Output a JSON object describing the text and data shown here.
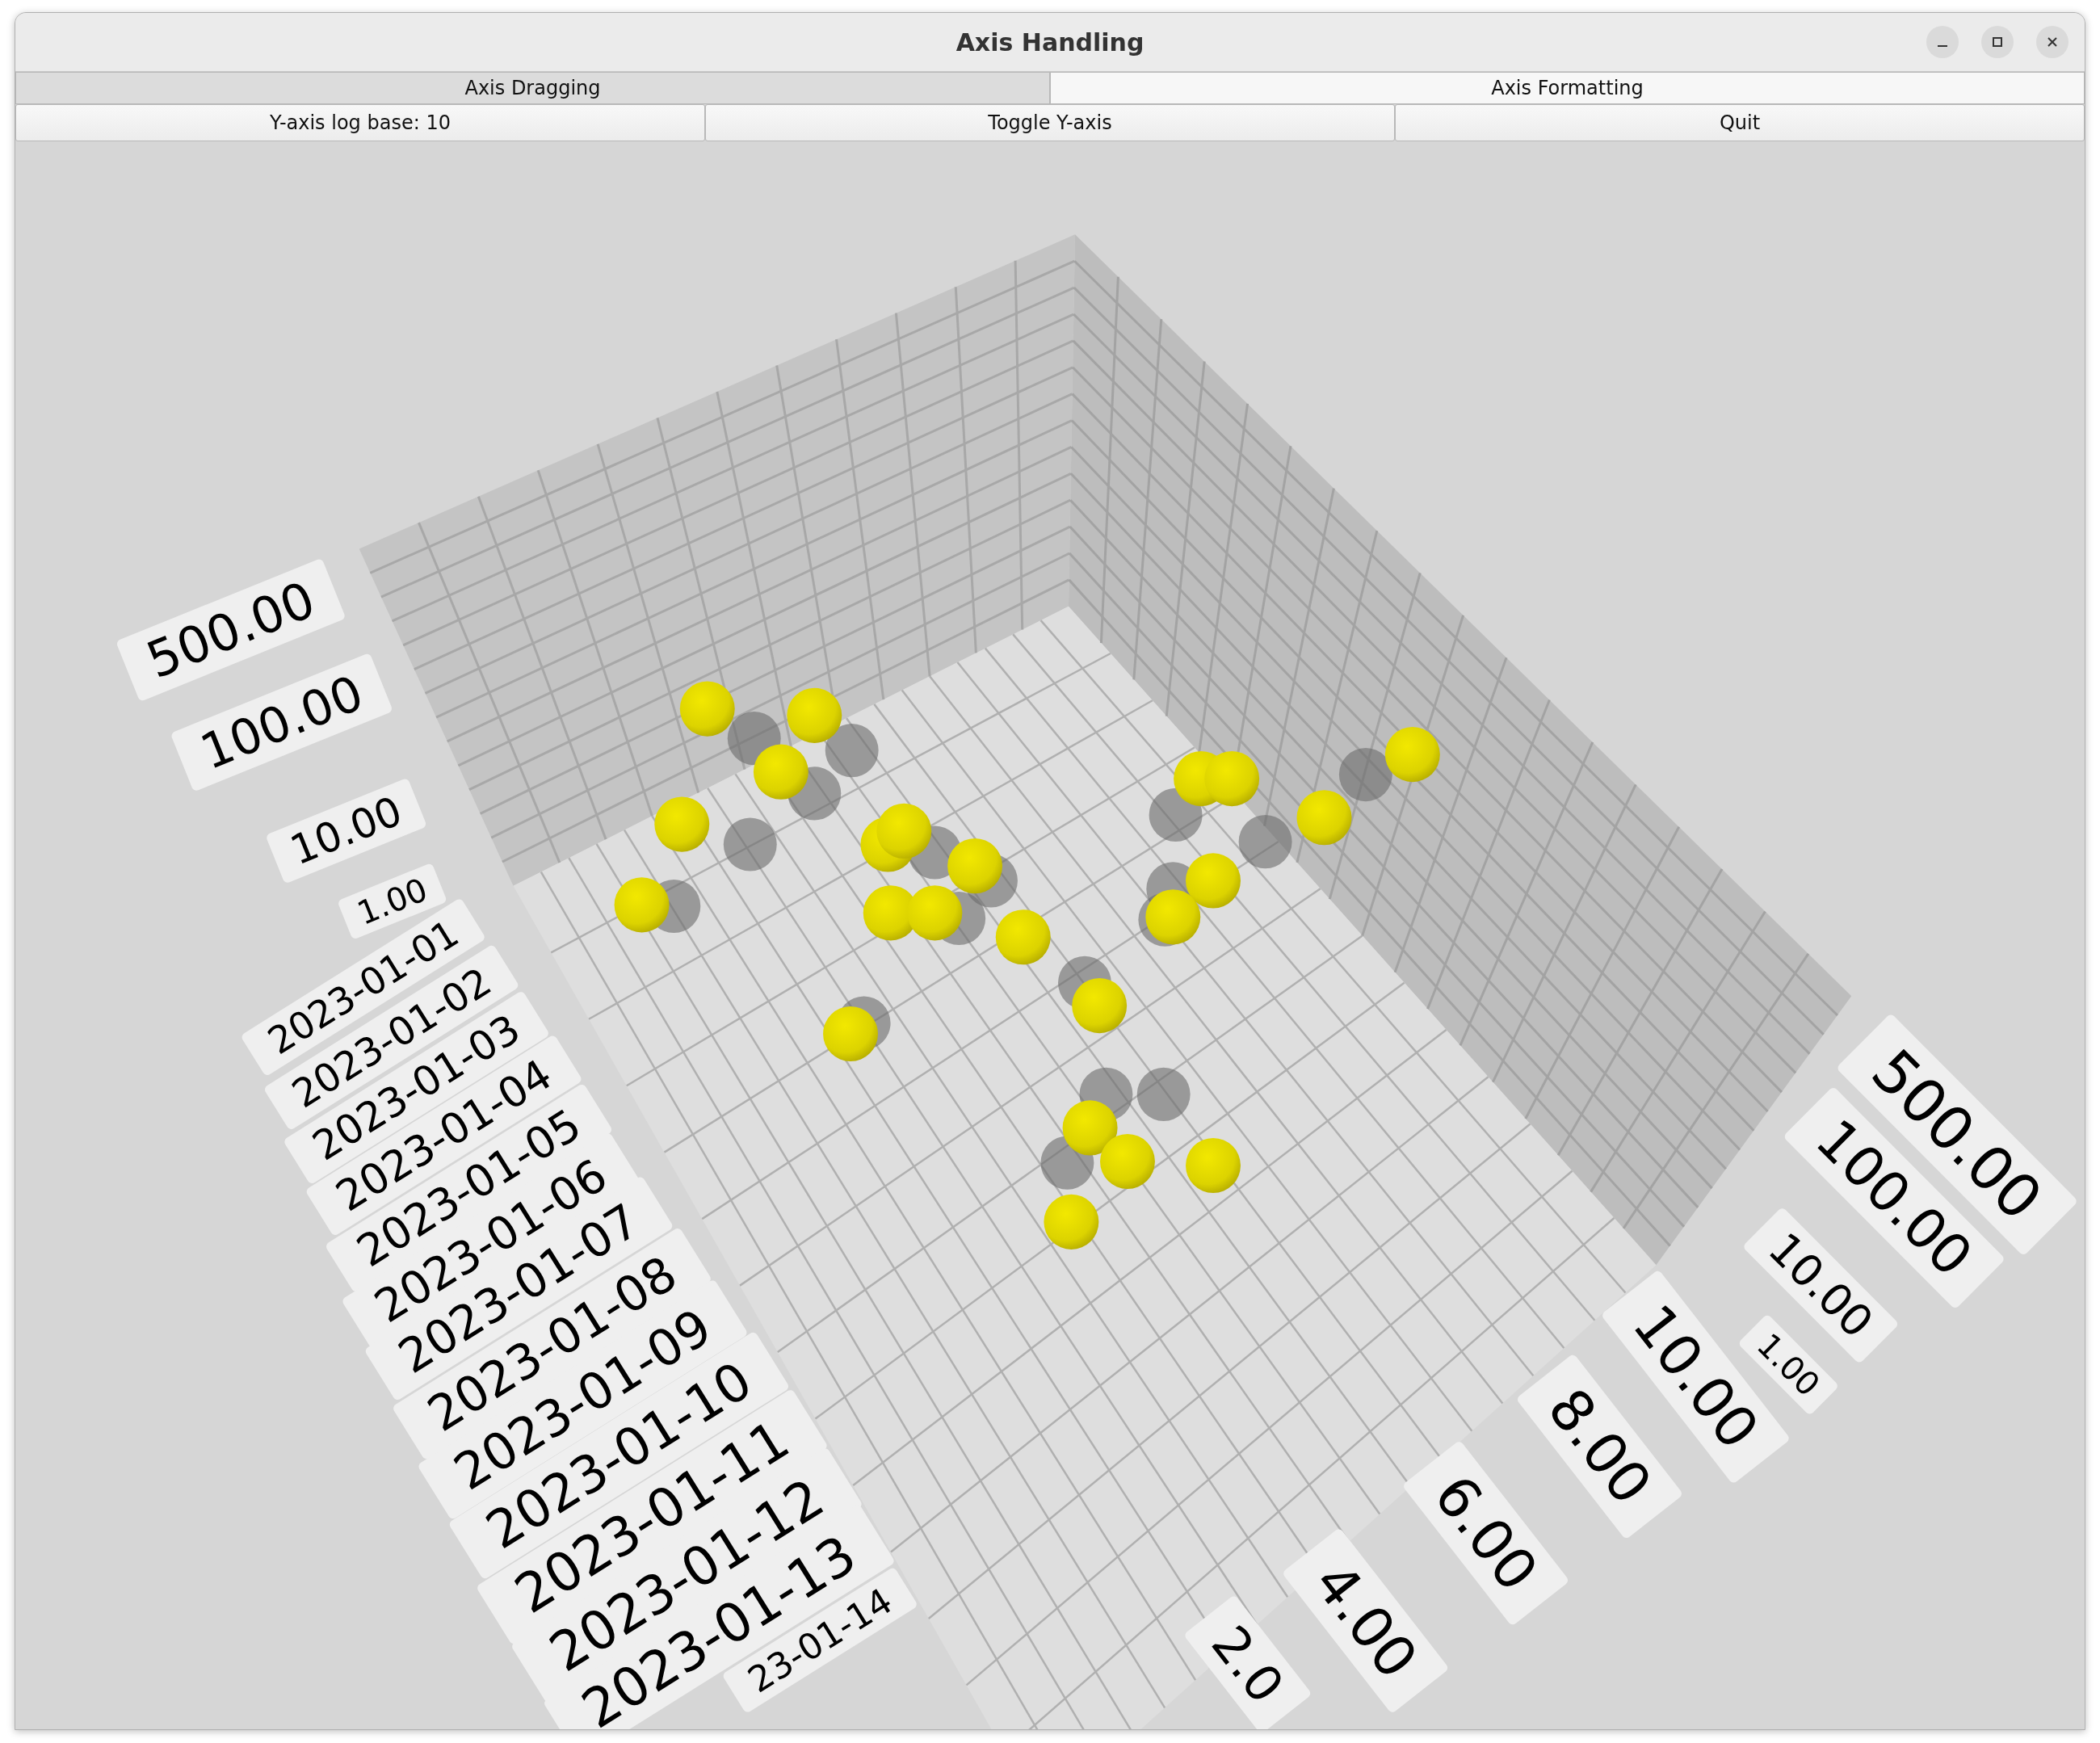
{
  "window": {
    "title": "Axis Handling"
  },
  "tabs": [
    {
      "label": "Axis Dragging",
      "selected": true
    },
    {
      "label": "Axis Formatting",
      "selected": false
    }
  ],
  "buttons": [
    "Y-axis log base: 10",
    "Toggle Y-axis",
    "Quit"
  ],
  "graph": {
    "y_axis_left_labels": [
      "500.00",
      "100.00",
      "10.00",
      "1.00"
    ],
    "x_axis_labels": [
      "2023-01-01",
      "2023-01-02",
      "2023-01-03",
      "2023-01-04",
      "2023-01-05",
      "2023-01-06",
      "2023-01-07",
      "2023-01-08",
      "2023-01-09",
      "2023-01-10",
      "2023-01-11",
      "2023-01-12",
      "2023-01-13",
      "23-01-14"
    ],
    "y_axis_right_labels": [
      "500.00",
      "100.00",
      "10.00",
      "1.00"
    ],
    "z_axis_labels": [
      "10.00",
      "8.00",
      "6.00",
      "4.00",
      "2.0"
    ]
  }
}
